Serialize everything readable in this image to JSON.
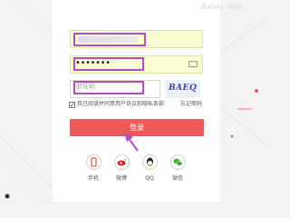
{
  "login_form": {
    "username_value": "",
    "password_value": "•••••••",
    "code_placeholder": "验证码",
    "captcha_text": "BAEQ",
    "agree_text": "我已阅读并同意用户协议和隐私条款",
    "forgot_link": "忘记密码",
    "login_button": "登录"
  },
  "social_login": [
    {
      "label": "手机",
      "icon": "phone-icon",
      "color": "#e8514b"
    },
    {
      "label": "微博",
      "icon": "weibo-icon",
      "color": "#e6162d"
    },
    {
      "label": "QQ",
      "icon": "qq-icon",
      "color": "#222222"
    },
    {
      "label": "微信",
      "icon": "wechat-icon",
      "color": "#3cb034"
    }
  ],
  "watermark": "Baidu 经验",
  "colors": {
    "button": "#f0595a",
    "highlight": "#b44cc4",
    "autofill": "#fafdd0"
  }
}
